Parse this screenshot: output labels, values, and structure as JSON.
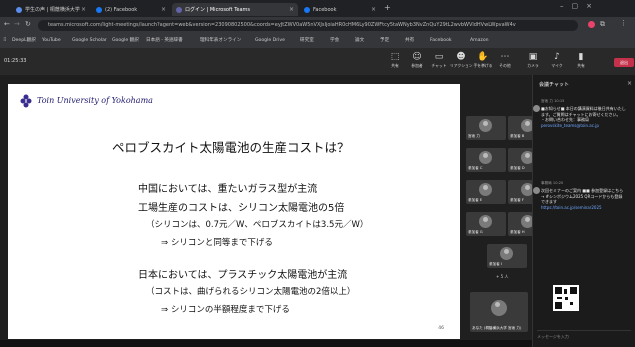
{
  "browser": {
    "tabs": [
      {
        "label": "学生の声 | 桐蔭横浜大学",
        "active": false
      },
      {
        "label": "(2) Facebook",
        "active": false
      },
      {
        "label": "ログイン | Microsoft Teams",
        "active": true
      },
      {
        "label": "Facebook",
        "active": false
      }
    ],
    "url": "teams.microsoft.com/light-meetings/launch?agent=web&version=23090802500&coords=eyJtZWV0aW5nVXJsIjoiaHR0cHM6Ly90ZWFtcy5taWNyb3NvZnQuY29tL2wvbWVldHVwLWpvaW4v",
    "bookmarks": [
      "DeepL翻訳",
      "YouTube",
      "Google Scholar",
      "Google 翻訳",
      "日本語 - 英語辞書",
      "理科年表オンライン",
      "Google Drive",
      "研究室",
      "学会",
      "論文",
      "予定",
      "共有",
      "Facebook",
      "Amazon"
    ]
  },
  "meeting": {
    "timer": "01:25:33",
    "toolbar": [
      {
        "icon": "share-icon",
        "label": "共有"
      },
      {
        "icon": "people-icon",
        "label": "参加者"
      },
      {
        "icon": "chat-icon",
        "label": "チャット"
      },
      {
        "icon": "react-icon",
        "label": "リアクション"
      },
      {
        "icon": "raise-hand-icon",
        "label": "手を挙げる"
      },
      {
        "icon": "more-icon",
        "label": "その他"
      },
      {
        "icon": "camera-icon",
        "label": "カメラ"
      },
      {
        "icon": "mic-icon",
        "label": "マイク"
      },
      {
        "icon": "speaker-icon",
        "label": "共有"
      }
    ],
    "leave_label": "退出"
  },
  "slide": {
    "university": "Toin University of Yokohama",
    "title": "ペロブスカイト太陽電池の生産コストは？",
    "lines": [
      "中国においては、重たいガラス型が主流",
      "工場生産のコストは、シリコン太陽電池の5倍",
      "（シリコンは、0.7元／W、ペロブスカイトは3.5元／W）",
      "⇒ シリコンと同等まで下げる",
      "日本においては、プラスチック太陽電池が主流",
      "（コストは、曲げられるシリコン太陽電池の2倍以上）",
      "⇒ シリコンの半額程度まで下げる"
    ],
    "page": "46"
  },
  "participants": [
    {
      "name": "宮坂 力"
    },
    {
      "name": "参加者 B"
    },
    {
      "name": "参加者 C"
    },
    {
      "name": "参加者 D"
    },
    {
      "name": "参加者 E"
    },
    {
      "name": "参加者 F"
    },
    {
      "name": "参加者 G"
    },
    {
      "name": "参加者 H"
    },
    {
      "name": "参加者 I"
    }
  ],
  "more_participants": "+ 5 人",
  "self_tile_name": "あなた (桐蔭横浜大学 宮坂 力)",
  "chat": {
    "title": "会議チャット",
    "messages": [
      {
        "meta": "宮坂 力 10:15",
        "text": "■お知らせ■ 本日の講演資料は後日共有いたします。ご質問はチャットにお寄せください。",
        "extra": "・お問い合わせ先：事務局",
        "link": "perovskite_teams@toin.ac.jp"
      },
      {
        "meta": "事務局 10:20",
        "text": "次回セミナーのご案内 ■■ 参加登録はこちら → #シンポジウム2025 QRコードからも登録できます",
        "link": "https://toin.ac.jp/seminar2025"
      }
    ],
    "input_placeholder": "メッセージを入力"
  }
}
